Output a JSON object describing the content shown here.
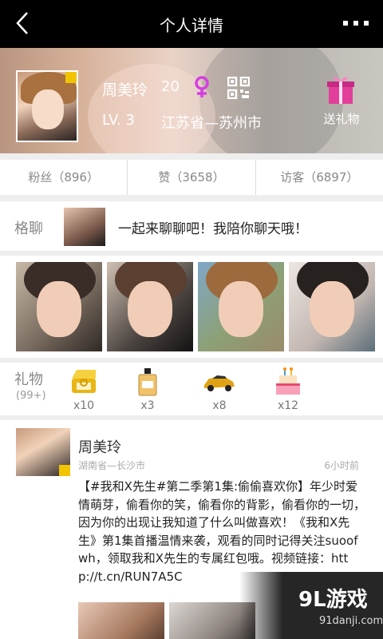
{
  "header": {
    "title": "个人详情",
    "back_icon": "back-arrow-icon",
    "more_icon": "more-dots-icon"
  },
  "profile": {
    "name": "周美玲",
    "age": "20",
    "level": "LV. 3",
    "region": "江苏省—苏州市",
    "gift_label": "送礼物",
    "gender_color": "#d53fe0",
    "gift_color": "#e23f9b"
  },
  "stats": [
    {
      "label": "粉丝（896）"
    },
    {
      "label": "赞（3658）"
    },
    {
      "label": "访客（6897）"
    }
  ],
  "chat": {
    "label": "格聊",
    "message": "一起来聊聊吧！我陪你聊天哦！"
  },
  "gifts": {
    "label": "礼物",
    "total": "(99+)",
    "items": [
      {
        "icon": "ring-box-icon",
        "count": "x10"
      },
      {
        "icon": "perfume-icon",
        "count": "x3"
      },
      {
        "icon": "sports-car-icon",
        "count": "x8"
      },
      {
        "icon": "birthday-cake-icon",
        "count": "x12"
      }
    ]
  },
  "post": {
    "name": "周美玲",
    "location": "湖南省—长沙市",
    "time": "6小时前",
    "text": "【#我和X先生#第二季第1集:偷偷喜欢你】年少时爱情萌芽，偷看你的笑，偷看你的背影，偷看你的一切，因为你的出现让我知道了什么叫做喜欢！《我和X先生》第1集首播温情来袭，观看的同时记得关注suoofwh，领取我和X先生的专属红包哦。视频链接：http://t.cn/RUN7A5C"
  },
  "watermark": {
    "logo": "9L游戏",
    "url": "91danji.com"
  }
}
